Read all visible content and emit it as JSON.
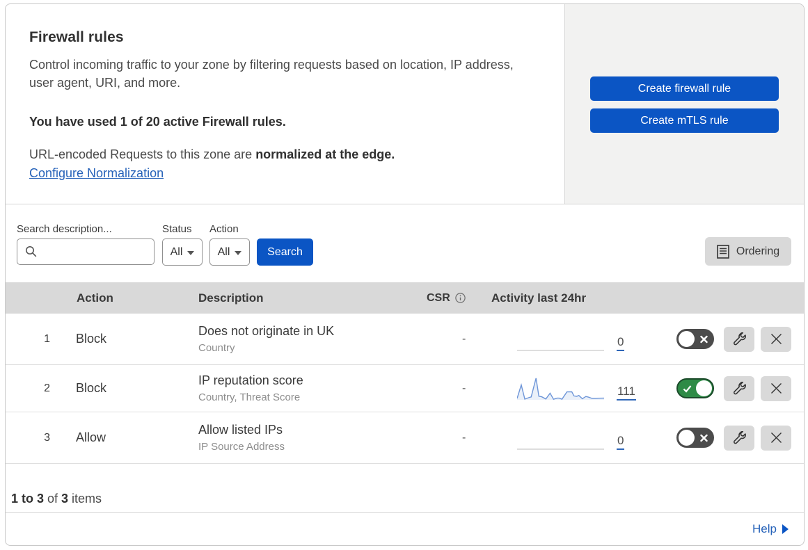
{
  "header": {
    "title": "Firewall rules",
    "description": "Control incoming traffic to your zone by filtering requests based on location, IP address, user agent, URI, and more.",
    "usage_bold": "You have used 1 of 20 active Firewall rules.",
    "normalization_prefix": "URL-encoded Requests to this zone are ",
    "normalization_bold": "normalized at the edge.",
    "configure_link": "Configure Normalization"
  },
  "actions_panel": {
    "create_firewall_rule_label": "Create firewall rule",
    "create_mtls_rule_label": "Create mTLS rule"
  },
  "filters": {
    "search_label": "Search description...",
    "search_value": "",
    "status_label": "Status",
    "status_value": "All",
    "action_label": "Action",
    "action_value": "All",
    "search_button_label": "Search",
    "ordering_button_label": "Ordering"
  },
  "table": {
    "headers": {
      "action": "Action",
      "description": "Description",
      "csr": "CSR",
      "activity": "Activity last 24hr"
    },
    "rows": [
      {
        "index": "1",
        "action": "Block",
        "description": "Does not originate in UK",
        "subtitle": "Country",
        "csr": "-",
        "activity_value": "0",
        "enabled": false,
        "has_sparkline": false
      },
      {
        "index": "2",
        "action": "Block",
        "description": "IP reputation score",
        "subtitle": "Country, Threat Score",
        "csr": "-",
        "activity_value": "111",
        "enabled": true,
        "has_sparkline": true
      },
      {
        "index": "3",
        "action": "Allow",
        "description": "Allow listed IPs",
        "subtitle": "IP Source Address",
        "csr": "-",
        "activity_value": "0",
        "enabled": false,
        "has_sparkline": false
      }
    ]
  },
  "chart_data": {
    "type": "area",
    "title": "Activity last 24hr sparkline (rule 2, total 111 requests)",
    "x": [
      0,
      6,
      11,
      18,
      20,
      27,
      31,
      35,
      41,
      47,
      52,
      57,
      60,
      64,
      71,
      78,
      81,
      85,
      88,
      93,
      98,
      102,
      107,
      112,
      117,
      124
    ],
    "values": [
      2,
      21,
      1,
      3.5,
      4,
      30.5,
      5,
      4.3,
      1.2,
      9.3,
      0.8,
      2.4,
      2.4,
      0.8,
      11.2,
      11.4,
      5.5,
      4.9,
      6.2,
      1.5,
      4.7,
      3.7,
      1.9,
      1.9,
      2.3,
      2.4
    ],
    "xlabel": "",
    "ylabel": "",
    "line_color": "#6d95d8",
    "fill_color": "rgba(109,149,216,0.14)",
    "baseline_color": "#c9c9c9"
  },
  "footer": {
    "count_prefix_bold": "1 to 3",
    "count_middle": " of ",
    "count_total_bold": "3",
    "count_suffix": " items",
    "help_label": "Help"
  },
  "colors": {
    "primary_blue": "#0b55c4",
    "link_blue": "#2662b9",
    "panel_gray": "#f2f2f1",
    "table_header_gray": "#d9d9d9",
    "toggle_on_green": "#2e8b46",
    "toggle_off_gray": "#4c4c4c"
  }
}
